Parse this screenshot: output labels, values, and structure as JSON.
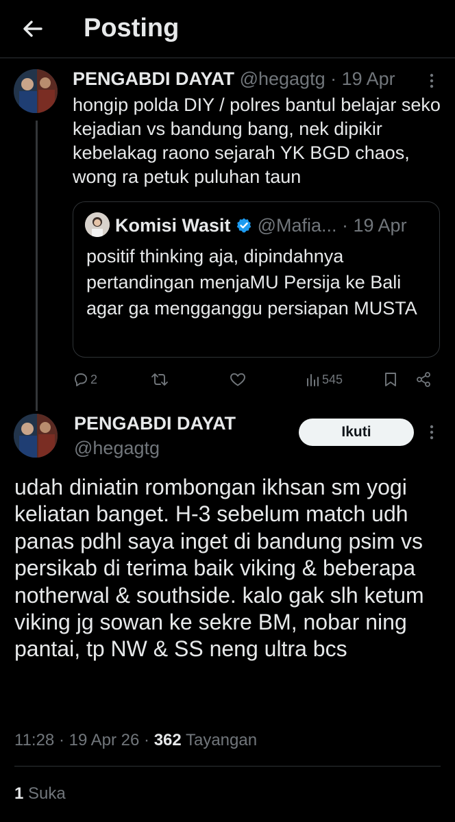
{
  "header": {
    "title": "Posting",
    "back_icon": "arrow-left-icon"
  },
  "tweet1": {
    "author_name": "PENGABDI DAYAT",
    "handle": "@hegagtg",
    "separator": " · ",
    "date": "19 Apr",
    "text": "hongip polda DIY / polres bantul belajar seko kejadian vs bandung bang, nek dipikir kebelakag raono sejarah YK BGD chaos, wong ra petuk puluhan taun",
    "quote": {
      "author_name": "Komisi Wasit",
      "verified": true,
      "handle": "@Mafia...",
      "separator": " · ",
      "date": "19 Apr",
      "text": "positif thinking aja, dipindahnya pertandingan menjaMU Persija ke Bali agar ga mengganggu persiapan MUSTA"
    },
    "actions": {
      "replies": "2",
      "retweets": "",
      "likes": "",
      "views": "545"
    }
  },
  "tweet2": {
    "author_name": "PENGABDI DAYAT",
    "handle": "@hegagtg",
    "follow_label": "Ikuti",
    "text": "udah diniatin rombongan ikhsan sm yogi keliatan banget. H-3 sebelum match udh panas pdhl saya inget di bandung psim vs persikab di terima baik viking & beberapa notherwal & southside. kalo gak slh ketum viking jg sowan ke sekre BM, nobar ning pantai, tp NW & SS neng ultra bcs",
    "time": "11:28",
    "separator": " · ",
    "date": "19 Apr 26",
    "separator2": " · ",
    "views_count": "362",
    "views_label": " Tayangan",
    "likes_count": "1",
    "likes_label": " Suka"
  },
  "colors": {
    "background": "#000000",
    "text": "#e7e9ea",
    "muted": "#71767b",
    "verified": "#1d9bf0",
    "divider": "#2f3336"
  }
}
